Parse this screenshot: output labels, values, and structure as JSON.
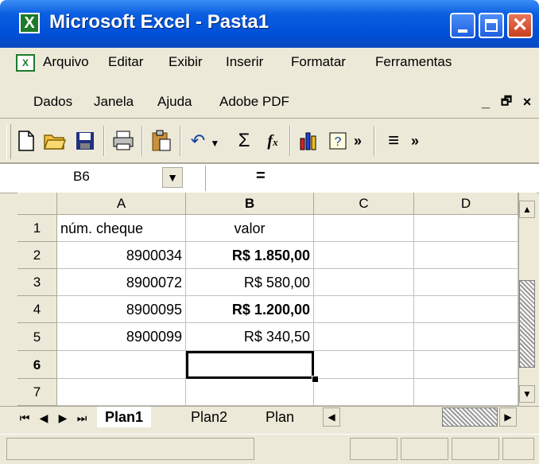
{
  "window": {
    "title": "Microsoft Excel - Pasta1",
    "app_icon_glyph": "X",
    "controls": [
      "minimize-icon",
      "maximize-icon",
      "close-icon"
    ]
  },
  "menus": {
    "row1": [
      "Arquivo",
      "Editar",
      "Exibir",
      "Inserir",
      "Formatar",
      "Ferramentas"
    ],
    "row2": [
      "Dados",
      "Janela",
      "Ajuda",
      "Adobe PDF"
    ],
    "doc_controls": {
      "minimize": "_",
      "restore": "🗗",
      "close": "×"
    }
  },
  "toolbar": {
    "icons": [
      "new-document-icon",
      "open-folder-icon",
      "save-icon",
      "print-icon",
      "paste-icon",
      "undo-icon",
      "autosum-icon",
      "function-icon",
      "chart-wizard-icon",
      "help-icon",
      "more-icon",
      "align-icon"
    ]
  },
  "formula_bar": {
    "name_box": "B6",
    "equals": "=",
    "content": ""
  },
  "sheet": {
    "columns": [
      "A",
      "B",
      "C",
      "D"
    ],
    "rows": [
      "1",
      "2",
      "3",
      "4",
      "5",
      "6",
      "7"
    ],
    "active_row": "6",
    "active_column": "B",
    "cells": {
      "A1": "núm. cheque",
      "B1": "valor",
      "A2": "8900034",
      "B2": "R$ 1.850,00",
      "A3": "8900072",
      "B3": "R$ 580,00",
      "A4": "8900095",
      "B4": "R$ 1.200,00",
      "A5": "8900099",
      "B5": "R$ 340,50"
    },
    "bold_cells": [
      "B2",
      "B4"
    ],
    "selected_cell": "B6"
  },
  "tabs": {
    "items": [
      "Plan1",
      "Plan2",
      "Plan"
    ],
    "active": "Plan1"
  },
  "colors": {
    "titlebar": "#0050d8",
    "chrome": "#ece9d8",
    "close_button": "#c9401e"
  }
}
